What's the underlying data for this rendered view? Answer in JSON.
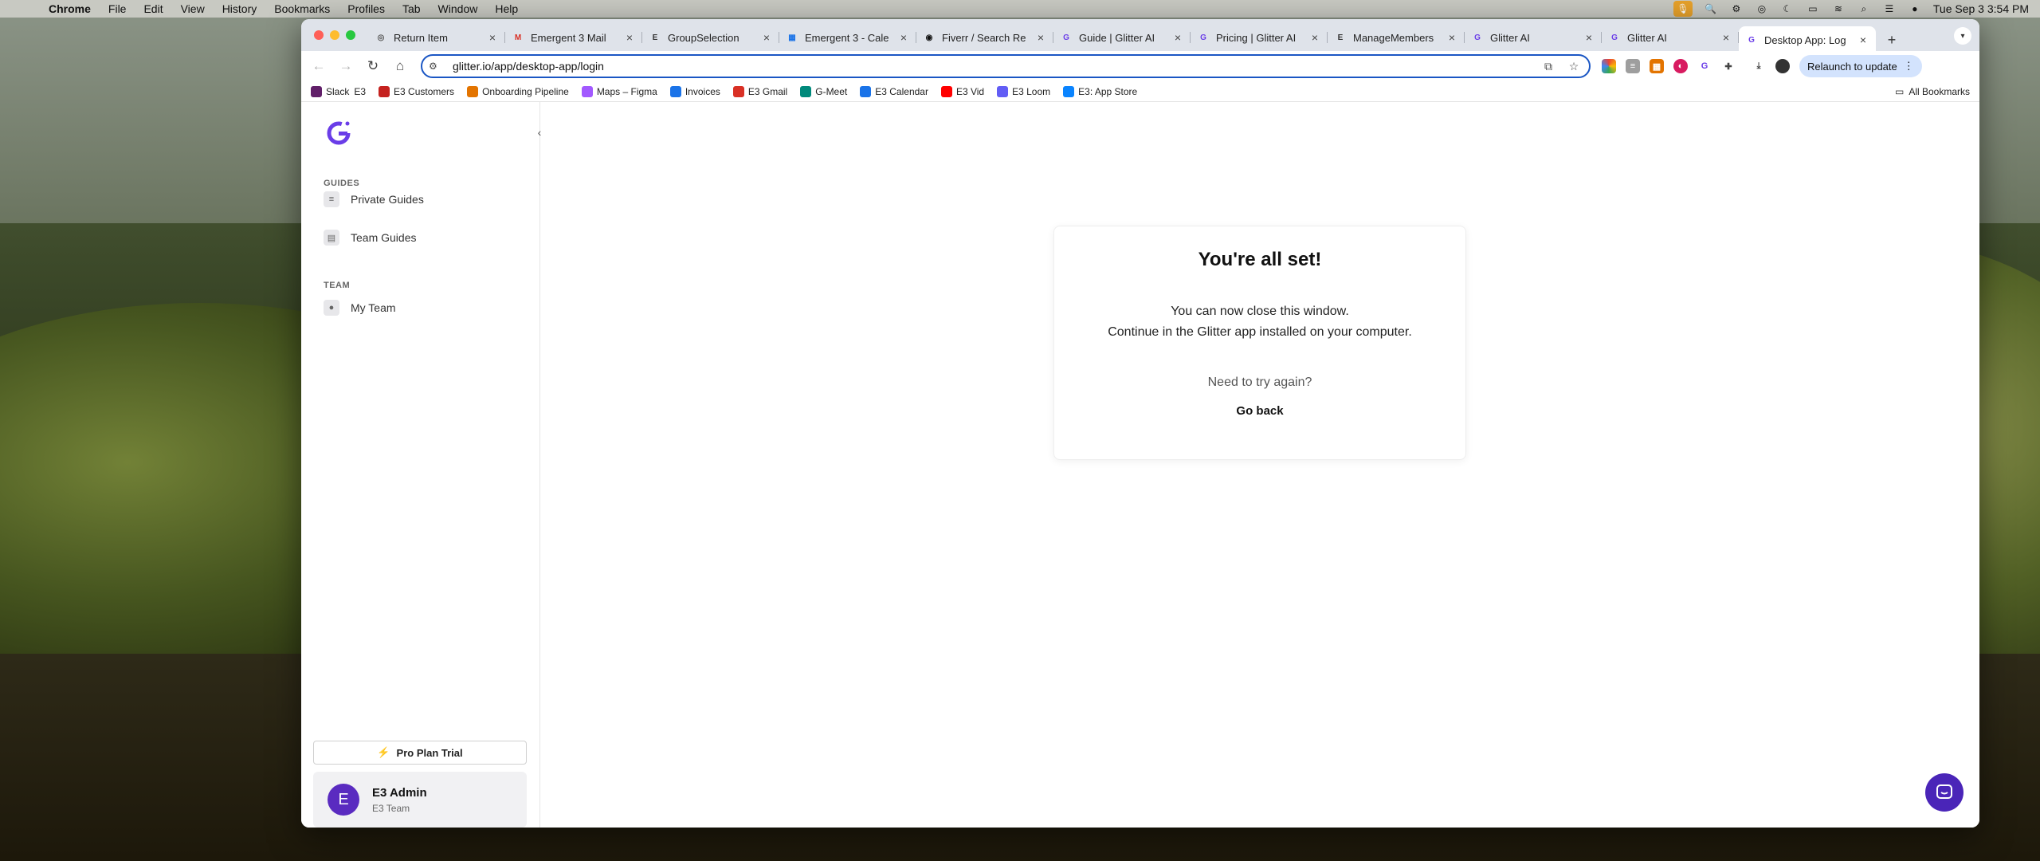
{
  "menubar": {
    "items": [
      "Chrome",
      "File",
      "Edit",
      "View",
      "History",
      "Bookmarks",
      "Profiles",
      "Tab",
      "Window",
      "Help"
    ],
    "datetime": "Tue Sep 3  3:54 PM"
  },
  "tabs": [
    {
      "title": "Return Item",
      "favicon": "return-icon",
      "color": "#555555"
    },
    {
      "title": "Emergent 3 Mail",
      "favicon": "gmail-icon",
      "color": "#d93025"
    },
    {
      "title": "GroupSelection",
      "favicon": "e3-icon",
      "color": "#333333"
    },
    {
      "title": "Emergent 3 - Cale",
      "favicon": "calendar-icon",
      "color": "#1a73e8"
    },
    {
      "title": "Fiverr / Search Re",
      "favicon": "fiverr-icon",
      "color": "#111111"
    },
    {
      "title": "Guide | Glitter AI",
      "favicon": "glitter-icon",
      "color": "#6a3de8"
    },
    {
      "title": "Pricing | Glitter AI",
      "favicon": "glitter-icon",
      "color": "#6a3de8"
    },
    {
      "title": "ManageMembers",
      "favicon": "e3-icon",
      "color": "#333333"
    },
    {
      "title": "Glitter AI",
      "favicon": "glitter-icon",
      "color": "#6a3de8"
    },
    {
      "title": "Glitter AI",
      "favicon": "glitter-icon",
      "color": "#6a3de8"
    },
    {
      "title": "Desktop App: Log",
      "favicon": "glitter-icon",
      "color": "#6a3de8",
      "active": true
    }
  ],
  "toolbar": {
    "url": "glitter.io/app/desktop-app/login",
    "relaunch_label": "Relaunch to update"
  },
  "bookmarks": [
    {
      "label": "Slack",
      "suffix": "E3",
      "color": "#611f69"
    },
    {
      "label": "E3 Customers",
      "color": "#c5221f"
    },
    {
      "label": "Onboarding Pipeline",
      "color": "#e37400"
    },
    {
      "label": "Maps – Figma",
      "color": "#a259ff"
    },
    {
      "label": "Invoices",
      "color": "#1a73e8"
    },
    {
      "label": "E3 Gmail",
      "color": "#d93025"
    },
    {
      "label": "G-Meet",
      "color": "#00897b"
    },
    {
      "label": "E3 Calendar",
      "color": "#1a73e8"
    },
    {
      "label": "E3 Vid",
      "color": "#ff0000"
    },
    {
      "label": "E3 Loom",
      "color": "#625df5"
    },
    {
      "label": "E3: App Store",
      "color": "#0a84ff"
    }
  ],
  "all_bookmarks_label": "All Bookmarks",
  "sidebar": {
    "guides_label": "GUIDES",
    "private_guides": "Private Guides",
    "team_guides": "Team Guides",
    "team_label": "TEAM",
    "my_team": "My Team",
    "pro_label": "Pro Plan Trial",
    "user": {
      "initial": "E",
      "name": "E3 Admin",
      "team": "E3 Team"
    }
  },
  "card": {
    "title": "You're all set!",
    "line1": "You can now close this window.",
    "line2": "Continue in the Glitter app installed on your computer.",
    "retry": "Need to try again?",
    "go_back": "Go back"
  },
  "colors": {
    "brand": "#5a2bc0",
    "omnibox_border": "#1a56c4",
    "relaunch_bg": "#d3e3fd"
  }
}
